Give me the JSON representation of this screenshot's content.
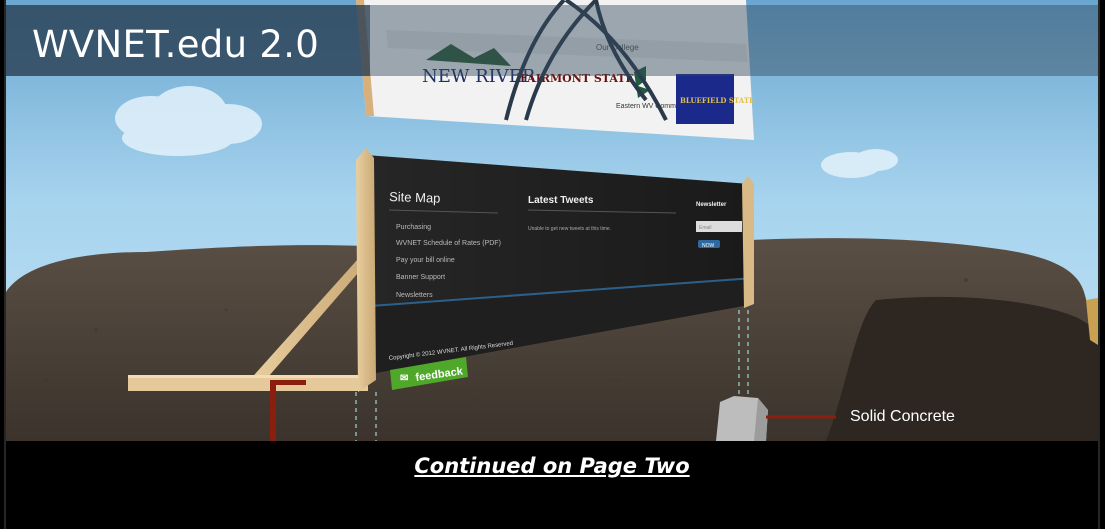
{
  "header": {
    "title": "WVNET.edu 2.0"
  },
  "sign_top": {
    "search_label": "Our College",
    "logos": [
      "NEW RIVER",
      "FAIRMONT STATE",
      "Eastern WV Community",
      "BLUEFIELD STATE"
    ]
  },
  "footer_mockup": {
    "site_map_heading": "Site Map",
    "site_map_links": [
      "Purchasing",
      "WVNET Schedule of Rates (PDF)",
      "Pay your bill online",
      "Banner Support",
      "Newsletters"
    ],
    "tweets_heading": "Latest Tweets",
    "tweets_body": "Unable to get new tweets at this time.",
    "newsletter_heading": "Newsletter",
    "newsletter_placeholder": "Email",
    "newsletter_button": "NOW",
    "copyright": "Copyright © 2012 WVNET. All Rights Reserved",
    "feedback_label": "feedback"
  },
  "annotation": {
    "concrete_label": "Solid Concrete"
  },
  "bottom": {
    "continued_link": "Continued on Page Two"
  },
  "colors": {
    "sky": "#9fd0ee",
    "dirt": "#4a4037",
    "header_overlay": "#283e52",
    "feedback_green": "#4fa82a"
  }
}
